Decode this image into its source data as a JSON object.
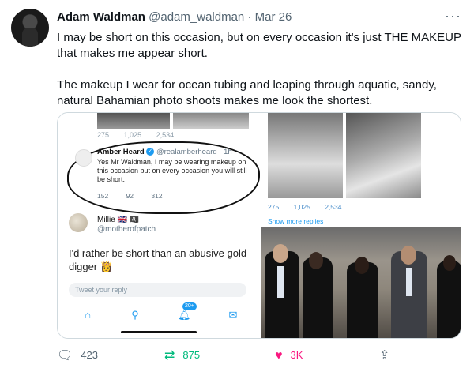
{
  "author": {
    "name": "Adam Waldman",
    "handle": "@adam_waldman",
    "separator": "·",
    "date": "Mar 26"
  },
  "more_label": "···",
  "body": {
    "line1": "I may be short on this occasion, but on every occasion it's just THE MAKEUP that makes me appear short.",
    "line2": "The makeup I wear for ocean tubing and leaping through aquatic, sandy, natural Bahamian photo shoots makes me look the shortest."
  },
  "media": {
    "screenshot_left": {
      "top_actions": {
        "replies": "275",
        "retweets": "1,025",
        "likes": "2,534"
      },
      "reply": {
        "name": "Amber Heard",
        "verified_glyph": "✓",
        "handle": "@realamberheard · 1h",
        "text": "Yes Mr Waldman, I may be wearing makeup on this occasion but on every occasion you will still be short.",
        "actions": {
          "replies": "152",
          "retweets": "92",
          "likes": "312"
        }
      },
      "reply2": {
        "name": "Millie 🇬🇧 🏴‍☠️",
        "handle": "@motherofpatch",
        "text": "I'd rather be short than an abusive gold digger 👸"
      },
      "tweet_reply_placeholder": "Tweet your reply",
      "notification_badge": "20+"
    },
    "screenshot_right": {
      "actions": {
        "replies": "275",
        "retweets": "1,025",
        "likes": "2,534"
      },
      "show_more": "Show more replies"
    }
  },
  "actions": {
    "replies": "423",
    "retweets": "875",
    "likes": "3K"
  },
  "icons": {
    "reply": "reply-icon",
    "retweet": "retweet-icon",
    "like": "heart-icon",
    "share": "share-icon",
    "more": "more-icon"
  },
  "colors": {
    "retweet": "#00ba7c",
    "like": "#f91880",
    "muted": "#536471",
    "link": "#1d9bf0"
  }
}
